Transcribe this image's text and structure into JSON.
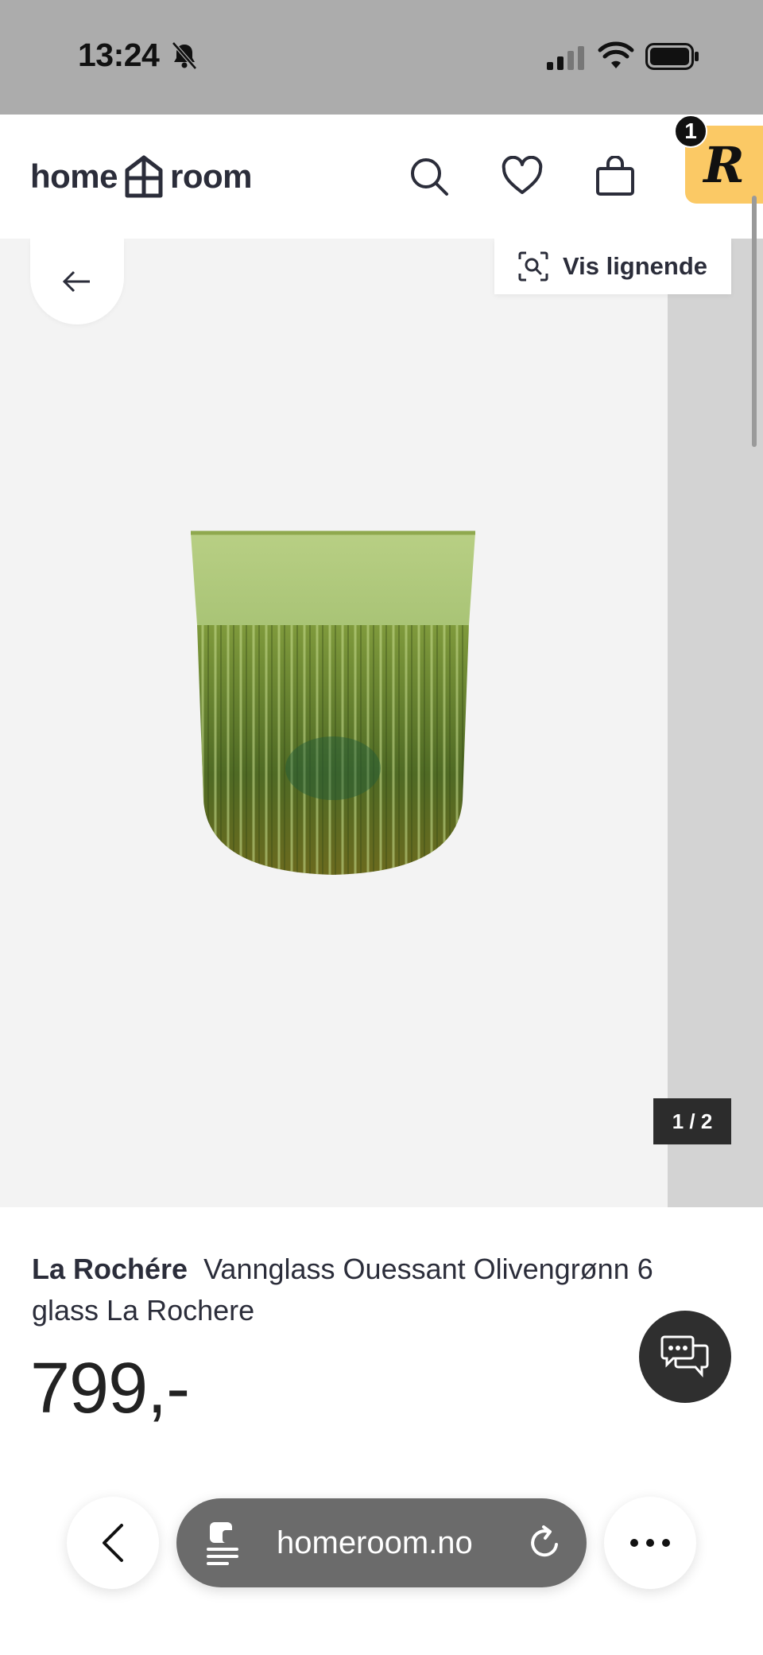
{
  "status_bar": {
    "time": "13:24"
  },
  "header": {
    "logo_left": "home",
    "logo_right": "room",
    "cart_badge_count": "1",
    "rewards_letter": "R"
  },
  "gallery": {
    "similar_label": "Vis lignende",
    "pager": "1 / 2"
  },
  "product": {
    "brand": "La Rochére",
    "name": "Vannglass Ouessant Olivengrønn 6 glass La Rochere",
    "price": "799,-"
  },
  "browser": {
    "url": "homeroom.no"
  },
  "colors": {
    "status_bg": "#acacac",
    "rewards_badge": "#fbc965",
    "gallery_bg": "#f3f3f3",
    "text_dark": "#2b2d3a",
    "glass_green": "#6f8a2a"
  }
}
